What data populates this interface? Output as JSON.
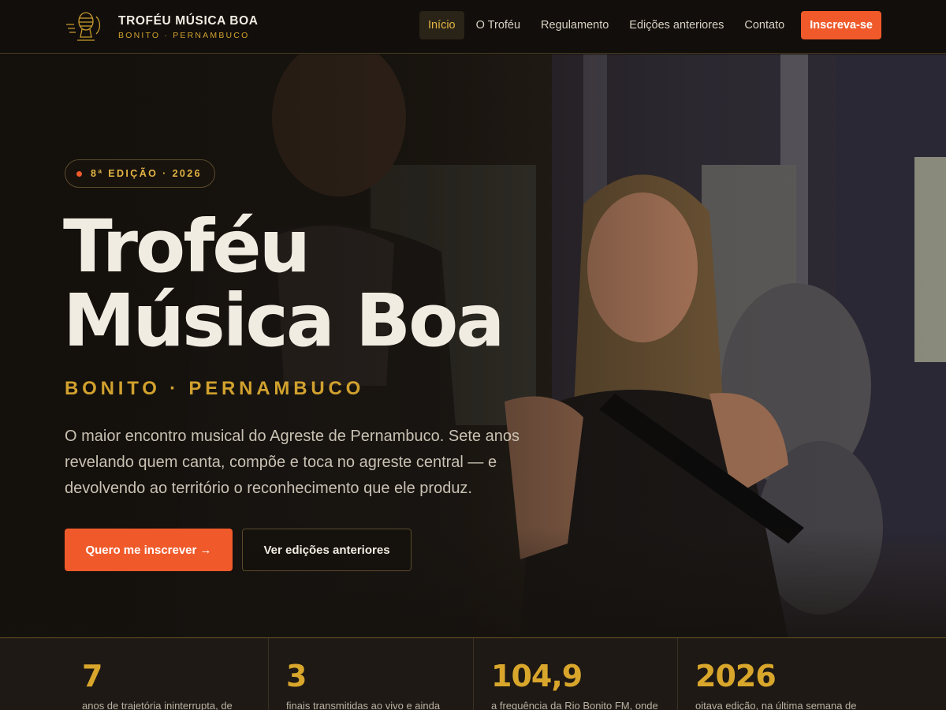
{
  "brand": {
    "title": "TROFÉU MÚSICA BOA",
    "subtitle": "BONITO · PERNAMBUCO",
    "logo_icon": "microphone-trophy-icon"
  },
  "nav": {
    "items": [
      {
        "label": "Início",
        "active": true
      },
      {
        "label": "O Troféu",
        "active": false
      },
      {
        "label": "Regulamento",
        "active": false
      },
      {
        "label": "Edições anteriores",
        "active": false
      },
      {
        "label": "Contato",
        "active": false
      }
    ],
    "cta_label": "Inscreva-se"
  },
  "hero": {
    "badge": "8ª EDIÇÃO · 2026",
    "title_line1": "Troféu",
    "title_line2": "Música Boa",
    "location": "BONITO · PERNAMBUCO",
    "lead": "O maior encontro musical do Agreste de Pernambuco. Sete anos revelando quem canta, compõe e toca no agreste central — e devolvendo ao território o reconhecimento que ele produz.",
    "primary_button": "Quero me inscrever →",
    "secondary_button": "Ver edições anteriores"
  },
  "stats": [
    {
      "value": "7",
      "desc": "anos de trajetória ininterrupta, de"
    },
    {
      "value": "3",
      "desc": "finais transmitidas ao vivo e ainda"
    },
    {
      "value": "104,9",
      "desc": "a frequência da Rio Bonito FM, onde"
    },
    {
      "value": "2026",
      "desc": "oitava edição, na última semana de"
    }
  ],
  "colors": {
    "accent": "#f05a2a",
    "gold": "#d1a12e",
    "background": "#15110d",
    "text": "#f1ece2"
  }
}
